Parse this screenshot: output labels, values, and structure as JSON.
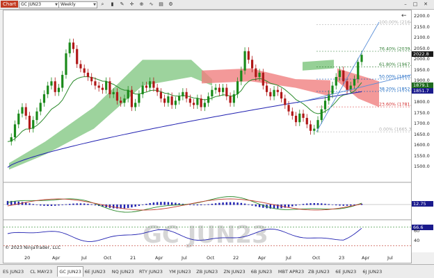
{
  "toolbar": {
    "tag": "Chart",
    "instrument": "GC JUN23",
    "period": "Weekly"
  },
  "chart_data": {
    "type": "line",
    "series_name": "GC JUN23",
    "watermark": "GC JUN23",
    "copyright": "© 2023 NinjaTrader, LLC",
    "ylim": [
      1450,
      2210
    ],
    "price_ticks": [
      "2200.0",
      "2150.0",
      "2100.0",
      "2050.0",
      "2000.0",
      "1950.0",
      "1900.0",
      "1850.0",
      "1800.0",
      "1750.0",
      "1700.0",
      "1650.0",
      "1600.0",
      "1550.0",
      "1500.0"
    ],
    "price_badges": [
      {
        "value": "2022.8",
        "color": "#1a1a1a"
      },
      {
        "value": "1879.1",
        "color": "#1e6b1e"
      },
      {
        "value": "1851.7",
        "color": "#1a1a8c"
      }
    ],
    "fib_levels": [
      {
        "label": "100.00% (2164.",
        "value": 2164,
        "color": "#b0b0b0"
      },
      {
        "label": "76.40% (2039.3",
        "value": 2039.3,
        "color": "#2e7d32"
      },
      {
        "label": "61.80% (1967.0",
        "value": 1967,
        "color": "#2e7d32"
      },
      {
        "label": "50.00% (1910.3",
        "value": 1910.3,
        "color": "#1565c0"
      },
      {
        "label": "38.20% (1852.7",
        "value": 1852.7,
        "color": "#1565c0"
      },
      {
        "label": "23.60% (1781.3",
        "value": 1781.3,
        "color": "#d32f2f"
      },
      {
        "label": "0.00% (1665.3)",
        "value": 1665.3,
        "color": "#b0b0b0"
      }
    ],
    "close": [
      1620,
      1640,
      1700,
      1750,
      1780,
      1740,
      1680,
      1720,
      1760,
      1800,
      1840,
      1880,
      1900,
      1850,
      1870,
      1930,
      2030,
      2080,
      2050,
      1980,
      1960,
      1940,
      1920,
      1900,
      1880,
      1870,
      1860,
      1900,
      1840,
      1850,
      1810,
      1800,
      1820,
      1860,
      1780,
      1800,
      1840,
      1880,
      1870,
      1900,
      1870,
      1850,
      1820,
      1800,
      1830,
      1790,
      1810,
      1830,
      1850,
      1820,
      1800,
      1790,
      1820,
      1780,
      1800,
      1830,
      1860,
      1870,
      1850,
      1870,
      1830,
      1800,
      1840,
      1900,
      1950,
      2040,
      2000,
      1960,
      1920,
      1940,
      1880,
      1850,
      1830,
      1860,
      1850,
      1820,
      1790,
      1760,
      1740,
      1710,
      1750,
      1730,
      1700,
      1670,
      1680,
      1720,
      1770,
      1810,
      1840,
      1880,
      1920,
      1950,
      1900,
      1860,
      1880,
      1910,
      1990,
      2022.8
    ],
    "ma_green_start": [
      1560,
      1580,
      1640,
      1700
    ],
    "ma_blue_range": [
      1500,
      1851.7
    ],
    "macd_value": "12.75",
    "rsi_value": "66.6",
    "rsi_ticks": [
      "60",
      "40"
    ]
  },
  "dates": [
    "20",
    "Apr",
    "Jul",
    "Oct",
    "21",
    "Apr",
    "Jul",
    "Oct",
    "22",
    "Apr",
    "Jul",
    "Oct",
    "23",
    "Apr",
    "Jul"
  ],
  "tabs": [
    "ES JUN23",
    "CL MAY23",
    "GC JUN23",
    "6E JUN23",
    "NQ JUN23",
    "RTY JUN23",
    "YM JUN23",
    "ZB JUN23",
    "ZN JUN23",
    "6B JUN23",
    "MBT APR23",
    "ZB JUN23",
    "6E JUN23",
    "6J JUN23"
  ]
}
